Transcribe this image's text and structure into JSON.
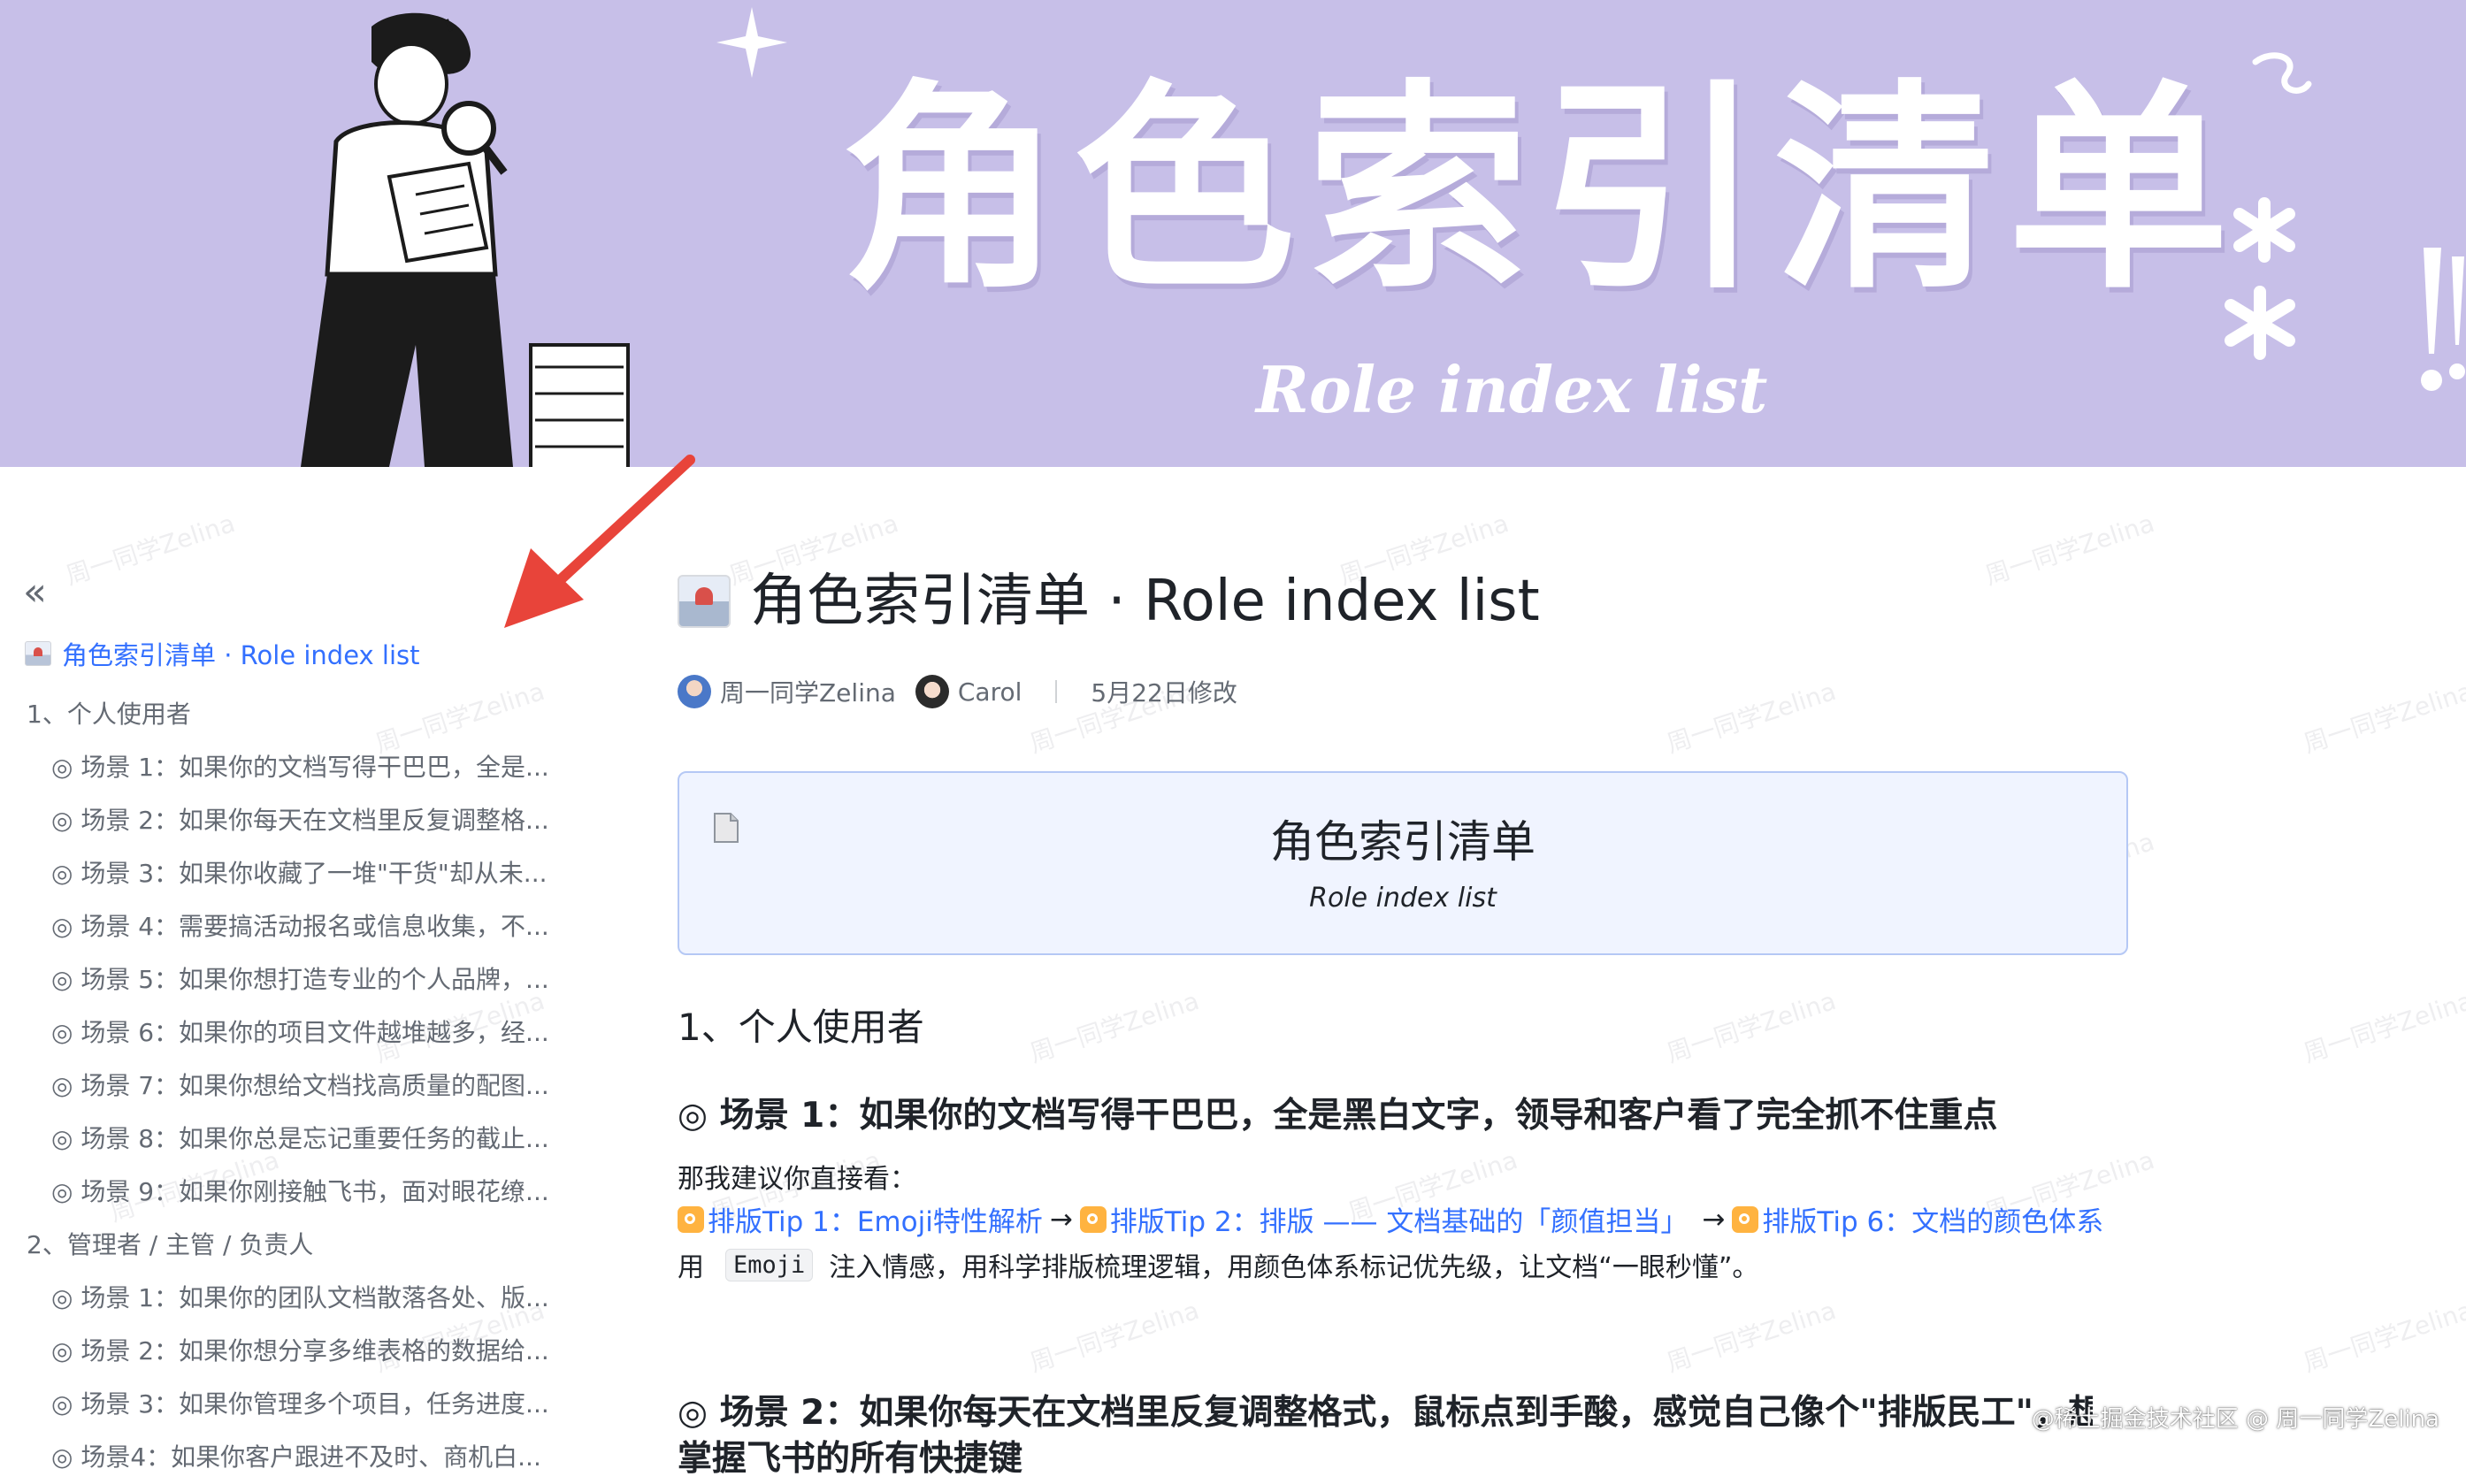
{
  "banner": {
    "title": "角色索引清单",
    "subtitle": "Role index list"
  },
  "watermark": "周一同学Zelina",
  "sidebar": {
    "collapse_icon": "double-chevron-left-icon",
    "doc_title": "角色索引清单 · Role index list",
    "items": [
      {
        "level": 1,
        "label": "1、个人使用者"
      },
      {
        "level": 2,
        "label": "◎ 场景 1：如果你的文档写得干巴巴，全是..."
      },
      {
        "level": 2,
        "label": "◎ 场景 2：如果你每天在文档里反复调整格..."
      },
      {
        "level": 2,
        "label": "◎ 场景 3：如果你收藏了一堆\"干货\"却从未..."
      },
      {
        "level": 2,
        "label": "◎ 场景 4：需要搞活动报名或信息收集，不..."
      },
      {
        "level": 2,
        "label": "◎ 场景 5：如果你想打造专业的个人品牌，..."
      },
      {
        "level": 2,
        "label": "◎ 场景 6：如果你的项目文件越堆越多，经..."
      },
      {
        "level": 2,
        "label": "◎ 场景 7：如果你想给文档找高质量的配图..."
      },
      {
        "level": 2,
        "label": "◎ 场景 8：如果你总是忘记重要任务的截止..."
      },
      {
        "level": 2,
        "label": "◎ 场景 9：如果你刚接触飞书，面对眼花缭..."
      },
      {
        "level": 1,
        "label": "2、管理者 / 主管 / 负责人"
      },
      {
        "level": 2,
        "label": "◎ 场景 1：如果你的团队文档散落各处、版..."
      },
      {
        "level": 2,
        "label": "◎ 场景 2：如果你想分享多维表格的数据给..."
      },
      {
        "level": 2,
        "label": "◎ 场景 3：如果你管理多个项目，任务进度..."
      },
      {
        "level": 2,
        "label": "◎ 场景4：如果你客户跟进不及时、商机白..."
      }
    ]
  },
  "doc": {
    "title": "角色索引清单 · Role index list",
    "authors": [
      "周一同学Zelina",
      "Carol"
    ],
    "modified": "5月22日修改",
    "callout": {
      "title": "角色索引清单",
      "subtitle": "Role index list"
    },
    "section1": "1、个人使用者",
    "scene1": {
      "heading": "◎ 场景 1：如果你的文档写得干巴巴，全是黑白文字，领导和客户看了完全抓不住重点",
      "intro": "那我建议你直接看：",
      "links": [
        "排版Tip 1：Emoji特性解析",
        "排版Tip 2：排版 —— 文档基础的「颜值担当」",
        "排版Tip 6：文档的颜色体系"
      ],
      "arrow": "→",
      "body_pre": "用",
      "code": "Emoji",
      "body_post": "注入情感，用科学排版梳理逻辑，用颜色体系标记优先级，让文档“一眼秒懂”。"
    },
    "scene2": {
      "heading": "◎ 场景 2：如果你每天在文档里反复调整格式，鼠标点到手酸，感觉自己像个\"排版民工\"，想",
      "heading_cont": "掌握飞书的所有快捷键"
    }
  },
  "footer_mark": "@稀土掘金技术社区 @ 周一同学Zelina",
  "colors": {
    "banner_bg": "#c7bfe8",
    "link": "#3370ff",
    "callout_bg": "#f0f4ff",
    "callout_border": "#b5c8f5",
    "arrow": "#e8443a"
  }
}
